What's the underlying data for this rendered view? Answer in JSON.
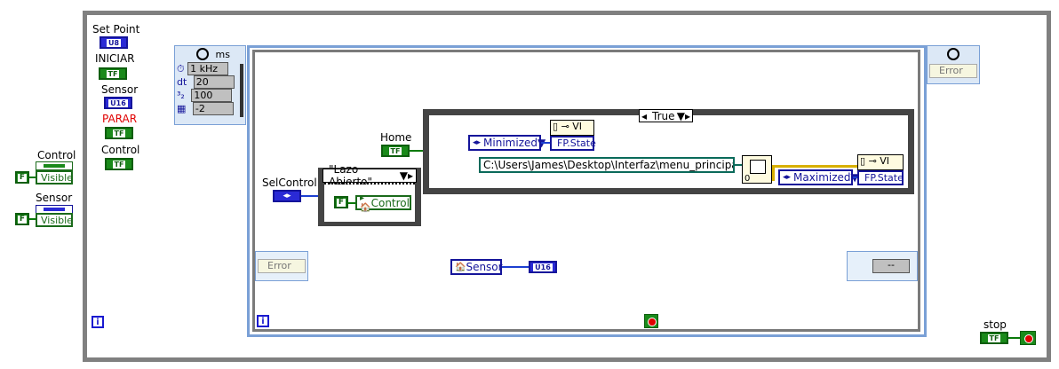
{
  "front_labels": {
    "set_point": "Set Point",
    "iniciar": "INICIAR",
    "sensor": "Sensor",
    "parar": "PARAR",
    "control": "Control",
    "control_left": "Control",
    "sensor_left": "Sensor",
    "selcontrol": "SelControl",
    "home": "Home",
    "stop": "stop"
  },
  "terminals": {
    "u8": "U8",
    "tf": "TF",
    "u16": "U16",
    "f": "F"
  },
  "property_nodes": {
    "visible": "Visible",
    "control_ref": "Control",
    "sensor_ref": "Sensor",
    "fp_state": "FP.State",
    "vi": "VI"
  },
  "timing": {
    "units": "ms",
    "freq": "1 kHz",
    "dt_label": "dt",
    "dt": "20",
    "offset": "100",
    "priority": "-2"
  },
  "case_selector": {
    "value": "\"Lazo Abierto\",",
    "bool_case": "True"
  },
  "constants": {
    "minimized": "Minimized",
    "maximized": "Maximized",
    "path": "C:\\Users\\James\\Desktop\\Interfaz\\menu_principal.vi",
    "zero": "0",
    "dashes": "--"
  },
  "error_clusters": {
    "error": "Error"
  },
  "info": "i",
  "colors": {
    "boolean_green": "#1a8a1a",
    "integer_blue": "#2a2ad6",
    "path_teal": "#0a6a5a",
    "parar_red": "#e00000",
    "loop_gray": "#808080"
  }
}
